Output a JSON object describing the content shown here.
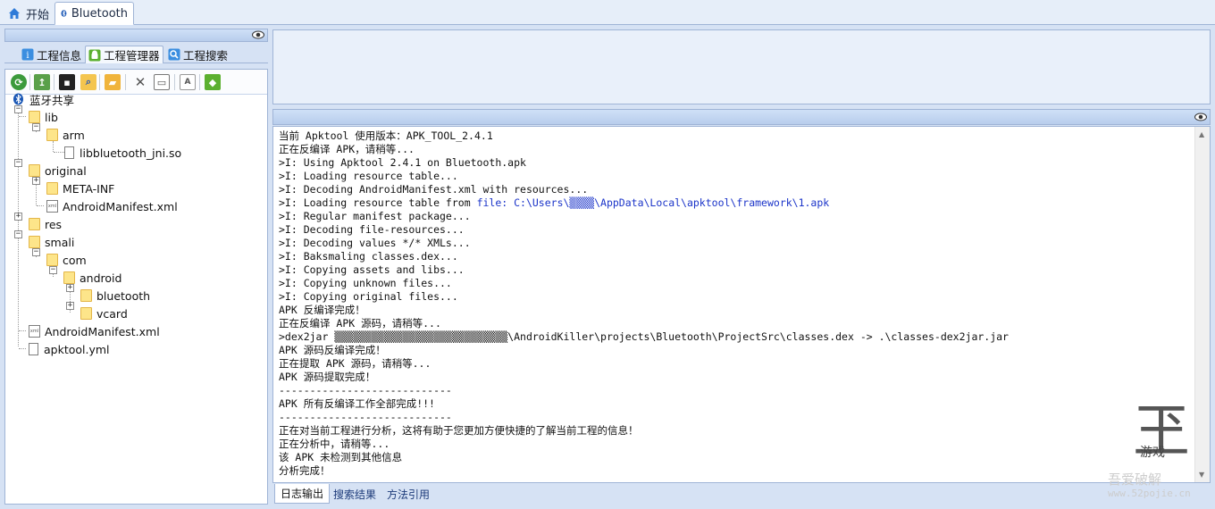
{
  "top_tabs": [
    {
      "label": "开始",
      "icon": "home-icon"
    },
    {
      "label": "Bluetooth",
      "icon": "bluetooth-icon"
    }
  ],
  "left_panel": {
    "tabs": [
      {
        "label": "工程信息",
        "icon": "info-icon"
      },
      {
        "label": "工程管理器",
        "icon": "android-icon"
      },
      {
        "label": "工程搜索",
        "icon": "search-icon"
      }
    ],
    "toolbar_icons": [
      "refresh-icon",
      "export-icon",
      "terminal-icon",
      "find-file-icon",
      "open-folder-icon",
      "delete-icon",
      "rename-icon",
      "text-icon",
      "android-build-icon"
    ],
    "tree": {
      "root": "蓝牙共享",
      "lib": "lib",
      "arm": "arm",
      "so": "libbluetooth_jni.so",
      "original": "original",
      "meta": "META-INF",
      "orig_manifest": "AndroidManifest.xml",
      "res": "res",
      "smali": "smali",
      "com": "com",
      "android": "android",
      "bluetooth": "bluetooth",
      "vcard": "vcard",
      "manifest": "AndroidManifest.xml",
      "apktool": "apktool.yml"
    }
  },
  "log": {
    "lines": [
      "当前 Apktool 使用版本：APK_TOOL_2.4.1",
      "正在反编译 APK，请稍等...",
      ">I: Using Apktool 2.4.1 on Bluetooth.apk",
      ">I: Loading resource table...",
      ">I: Decoding AndroidManifest.xml with resources...",
      ">I: Loading resource table from ",
      ">I: Regular manifest package...",
      ">I: Decoding file-resources...",
      ">I: Decoding values */* XMLs...",
      ">I: Baksmaling classes.dex...",
      ">I: Copying assets and libs...",
      ">I: Copying unknown files...",
      ">I: Copying original files...",
      "APK 反编译完成！",
      "正在反编译 APK 源码，请稍等...",
      ">dex2jar ",
      "APK 源码反编译完成！",
      "正在提取 APK 源码，请稍等...",
      "APK 源码提取完成！",
      "----------------------------",
      "APK 所有反编译工作全部完成!!!",
      "----------------------------",
      "正在对当前工程进行分析，这将有助于您更加方便快捷的了解当前工程的信息！",
      "正在分析中，请稍等...",
      "该 APK 未检测到其他信息",
      "分析完成！"
    ],
    "framework_link": "file: C:\\Users\\▒▒▒▒\\AppData\\Local\\apktool\\framework\\1.apk",
    "dex2jar_path": "▒▒▒▒▒▒▒▒▒▒▒▒▒▒▒▒▒▒▒▒▒▒▒▒▒▒▒▒\\AndroidKiller\\projects\\Bluetooth\\ProjectSrc\\classes.dex -> .\\classes-dex2jar.jar"
  },
  "bottom_tabs": [
    "日志输出",
    "搜索结果",
    "方法引用"
  ],
  "watermark": {
    "logo": "玊",
    "sub": "游戏",
    "text1": "吾爱破解",
    "text2": "www.52pojie.cn"
  }
}
